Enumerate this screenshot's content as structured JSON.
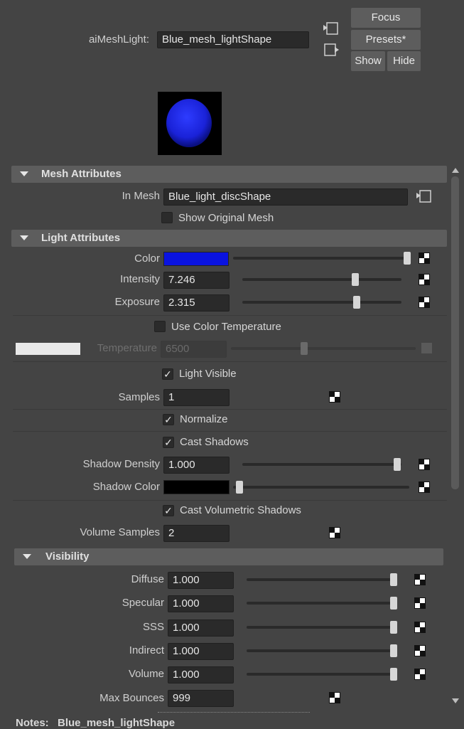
{
  "header": {
    "node_label": "aiMeshLight:",
    "node_name": "Blue_mesh_lightShape",
    "focus_label": "Focus",
    "presets_label": "Presets*",
    "show_label": "Show",
    "hide_label": "Hide"
  },
  "preview": {
    "swatch_color": "#2a35e6",
    "background": "#000000"
  },
  "mesh_section": {
    "title": "Mesh Attributes",
    "in_mesh_label": "In Mesh",
    "in_mesh_value": "Blue_light_discShape",
    "show_original_label": "Show Original Mesh",
    "show_original_checked": false
  },
  "light_section": {
    "title": "Light Attributes",
    "color_label": "Color",
    "color_value": "#0a13e0",
    "color_slider": 1.0,
    "intensity_label": "Intensity",
    "intensity_value": "7.246",
    "intensity_slider": 0.71,
    "exposure_label": "Exposure",
    "exposure_value": "2.315",
    "exposure_slider": 0.72,
    "use_temp_label": "Use Color Temperature",
    "use_temp_checked": false,
    "temperature_label": "Temperature",
    "temperature_value": "6500",
    "temperature_swatch": "#e8e8e8",
    "temperature_slider": 0.4,
    "light_visible_label": "Light Visible",
    "light_visible_checked": true,
    "samples_label": "Samples",
    "samples_value": "1",
    "normalize_label": "Normalize",
    "normalize_checked": true,
    "cast_shadows_label": "Cast Shadows",
    "cast_shadows_checked": true,
    "shadow_density_label": "Shadow Density",
    "shadow_density_value": "1.000",
    "shadow_density_slider": 1.0,
    "shadow_color_label": "Shadow Color",
    "shadow_color_value": "#000000",
    "shadow_color_slider": 0.0,
    "cast_vol_label": "Cast Volumetric Shadows",
    "cast_vol_checked": true,
    "volume_samples_label": "Volume Samples",
    "volume_samples_value": "2"
  },
  "visibility_section": {
    "title": "Visibility",
    "rows": [
      {
        "label": "Diffuse",
        "value": "1.000"
      },
      {
        "label": "Specular",
        "value": "1.000"
      },
      {
        "label": "SSS",
        "value": "1.000"
      },
      {
        "label": "Indirect",
        "value": "1.000"
      },
      {
        "label": "Volume",
        "value": "1.000"
      }
    ],
    "max_bounces_label": "Max Bounces",
    "max_bounces_value": "999"
  },
  "notes": {
    "label": "Notes:",
    "value": "Blue_mesh_lightShape"
  },
  "check_glyph": "✓"
}
